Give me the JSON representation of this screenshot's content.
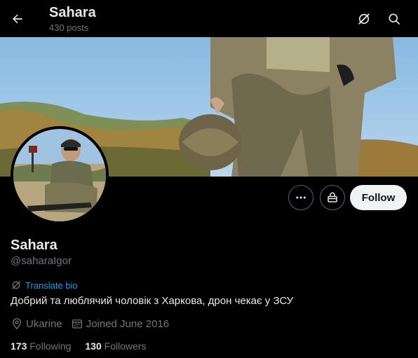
{
  "header": {
    "title": "Sahara",
    "subtitle": "430 posts",
    "back_icon": "arrow-left-icon",
    "grok_icon": "grok-icon",
    "search_icon": "search-icon"
  },
  "profile": {
    "name": "Sahara",
    "handle": "@saharaIgor",
    "translate_label": "Translate bio",
    "bio": "Добрий та люблячий чоловік з Харкова, дрон чекає у ЗСУ",
    "location": "Ukarine",
    "joined": "Joined June 2016",
    "following_count": "173",
    "following_label": "Following",
    "followers_count": "130",
    "followers_label": "Followers"
  },
  "actions": {
    "more_icon": "more-icon",
    "subscribe_icon": "subscribe-icon",
    "follow_label": "Follow"
  },
  "colors": {
    "background": "#000000",
    "text": "#e7e9ea",
    "muted": "#71767b",
    "link": "#1d9bf0",
    "follow_bg": "#eff3f4"
  }
}
